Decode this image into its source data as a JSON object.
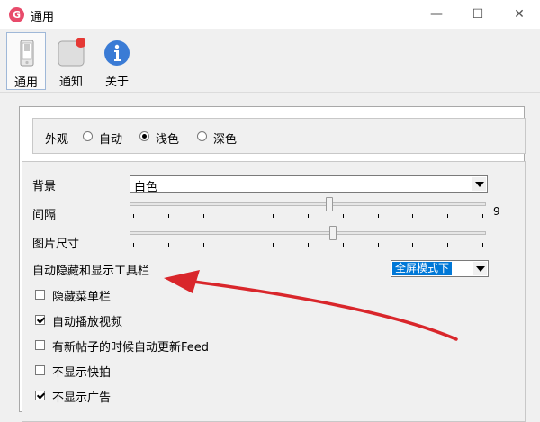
{
  "window": {
    "title": "通用",
    "app_icon_letter": "G",
    "minimize_glyph": "—",
    "maximize_glyph": "☐",
    "close_glyph": "✕"
  },
  "toolbar": {
    "items": [
      {
        "label": "通用",
        "icon": "phone-icon",
        "active": true
      },
      {
        "label": "通知",
        "icon": "notification-icon",
        "badge_color": "#e53935"
      },
      {
        "label": "关于",
        "icon": "info-icon",
        "icon_color": "#3a7bd5"
      }
    ]
  },
  "appearance": {
    "label": "外观",
    "options": [
      "自动",
      "浅色",
      "深色"
    ],
    "selected": "浅色"
  },
  "background": {
    "label": "背景",
    "value": "白色"
  },
  "spacing": {
    "label": "间隔",
    "value": "9",
    "level_fraction": 0.56
  },
  "image_size": {
    "label": "图片尺寸",
    "level_fraction": 0.57
  },
  "toolbar_autohide": {
    "label": "自动隐藏和显示工具栏",
    "value": "全屏模式下",
    "highlight_color": "#0078d7"
  },
  "checkboxes": [
    {
      "label": "隐藏菜单栏",
      "checked": false
    },
    {
      "label": "自动播放视频",
      "checked": true
    },
    {
      "label": "有新帖子的时候自动更新Feed",
      "checked": false
    },
    {
      "label": "不显示快拍",
      "checked": false
    },
    {
      "label": "不显示广告",
      "checked": true
    }
  ],
  "annotation": {
    "arrow_color": "#d9262b"
  }
}
